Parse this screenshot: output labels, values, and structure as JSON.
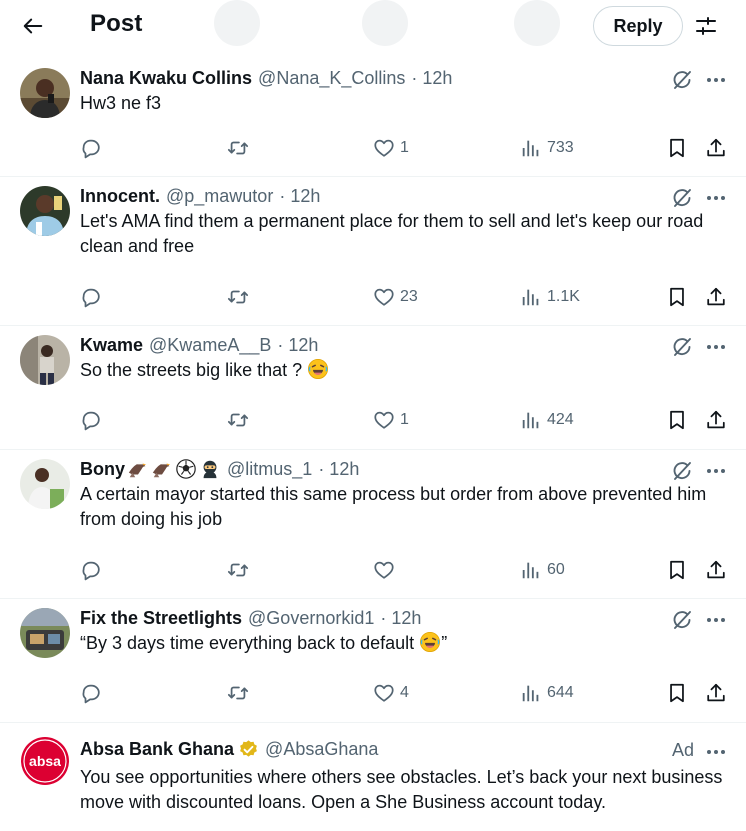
{
  "header": {
    "title": "Post",
    "reply_label": "Reply"
  },
  "tweets": [
    {
      "name": "Nana Kwaku Collins",
      "handle": "@Nana_K_Collins",
      "time": "· 12h",
      "text": "Hw3 ne f3",
      "likes": "1",
      "views": "733"
    },
    {
      "name": "Innocent.",
      "handle": "@p_mawutor",
      "time": "· 12h",
      "text": "Let's AMA find them a permanent place for them to sell and let's keep our road clean and free",
      "likes": "23",
      "views": "1.1K"
    },
    {
      "name": "Kwame",
      "handle": "@KwameA__B",
      "time": "· 12h",
      "text": "So the streets big like that ?",
      "likes": "1",
      "views": "424"
    },
    {
      "name": "Bony",
      "handle": "@litmus_1",
      "time": "· 12h",
      "text": "A certain mayor started this same process but order from above prevented him from doing his job",
      "likes": "",
      "views": "60"
    },
    {
      "name": "Fix the Streetlights",
      "handle": "@Governorkid1",
      "time": "· 12h",
      "text": "“By 3 days time everything back to default",
      "text_end": "”",
      "likes": "4",
      "views": "644"
    }
  ],
  "ad": {
    "name": "Absa Bank Ghana",
    "handle": "@AbsaGhana",
    "label": "Ad",
    "logo_text": "absa",
    "text": "You see opportunities where others see obstacles. Let’s back your next business move with discounted loans. Open a She Business account today."
  },
  "colors": {
    "text": "#0f1419",
    "secondary": "#536471",
    "divider": "#eff3f4",
    "absa_red": "#dc0032",
    "verified_gold": "#e2b719"
  },
  "icons": [
    "back-arrow-icon",
    "settings-sliders-icon",
    "grok-icon",
    "more-icon",
    "reply-icon",
    "retweet-icon",
    "like-icon",
    "views-icon",
    "bookmark-icon",
    "share-icon",
    "laughing-emoji-icon",
    "verified-gold-badge-icon"
  ]
}
